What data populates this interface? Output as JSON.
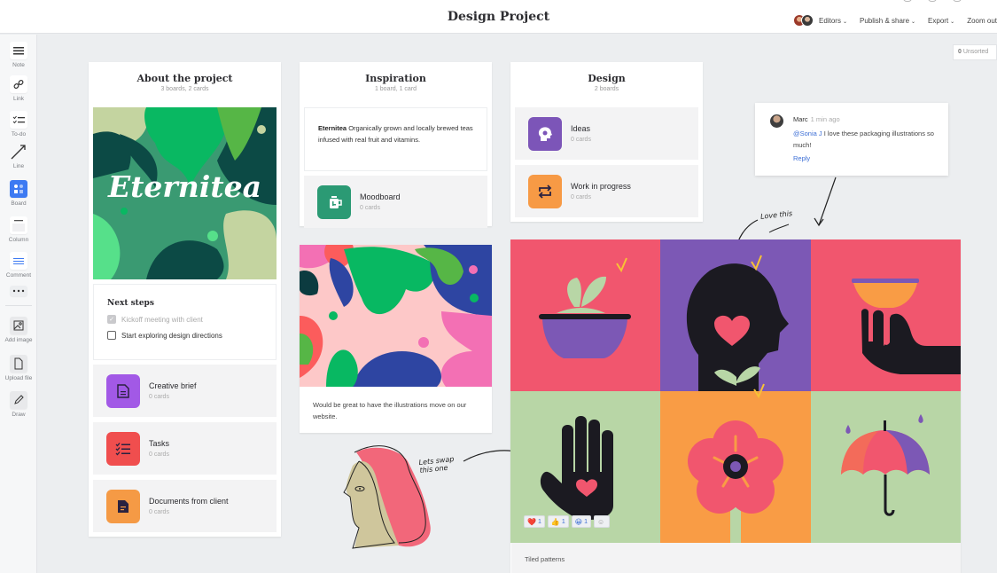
{
  "header": {
    "title": "Design Project",
    "editors_label": "Editors",
    "publish_label": "Publish & share",
    "export_label": "Export",
    "zoom_label": "Zoom out"
  },
  "unsorted": {
    "count": "0",
    "label": "Unsorted"
  },
  "sidebar": {
    "tools": [
      {
        "label": "Note",
        "icon": "note-icon"
      },
      {
        "label": "Link",
        "icon": "link-icon"
      },
      {
        "label": "To-do",
        "icon": "todo-icon"
      },
      {
        "label": "Line",
        "icon": "line-icon"
      },
      {
        "label": "Board",
        "icon": "board-icon"
      },
      {
        "label": "Column",
        "icon": "column-icon"
      },
      {
        "label": "Comment",
        "icon": "comment-icon"
      },
      {
        "label": "",
        "icon": "more-icon"
      },
      {
        "label": "Add image",
        "icon": "add-image-icon"
      },
      {
        "label": "Upload file",
        "icon": "upload-file-icon"
      },
      {
        "label": "Draw",
        "icon": "draw-icon"
      }
    ]
  },
  "columns": {
    "about": {
      "title": "About the project",
      "subtitle": "3 boards, 2 cards",
      "image_text": "Eternitea",
      "next_steps": {
        "title": "Next steps",
        "items": [
          {
            "label": "Kickoff meeting with client",
            "checked": true
          },
          {
            "label": "Start exploring design directions",
            "checked": false
          }
        ]
      },
      "boards": [
        {
          "name": "Creative brief",
          "count": "0 cards",
          "color": "#a259e6"
        },
        {
          "name": "Tasks",
          "count": "0 cards",
          "color": "#f04e4e"
        },
        {
          "name": "Documents from client",
          "count": "0 cards",
          "color": "#f59a45"
        }
      ]
    },
    "inspiration": {
      "title": "Inspiration",
      "subtitle": "1 board, 1 card",
      "note_bold": "Eternitea",
      "note_text": " Organically grown and locally brewed teas infused with real fruit and vitamins.",
      "boards": [
        {
          "name": "Moodboard",
          "count": "0 cards",
          "color": "#2b9a74"
        }
      ],
      "image_caption": "Would be great to have the illustrations move on our website."
    },
    "design": {
      "title": "Design",
      "subtitle": "2 boards",
      "boards": [
        {
          "name": "Ideas",
          "count": "0 cards",
          "color": "#7c55b8"
        },
        {
          "name": "Work in progress",
          "count": "0 cards",
          "color": "#f79a45"
        }
      ]
    }
  },
  "comment": {
    "author": "Marc",
    "time": "1 min ago",
    "mention": "@Sonia J",
    "text": " I love these packaging illustrations so much!",
    "reply_label": "Reply"
  },
  "tiled": {
    "caption": "Tiled patterns",
    "reactions": [
      {
        "emoji": "❤️",
        "count": "1"
      },
      {
        "emoji": "👍",
        "count": "1"
      },
      {
        "emoji": "😀",
        "count": "1"
      }
    ]
  },
  "annotations": {
    "love_this": "Love this",
    "swap_line1": "Lets swap",
    "swap_line2": "this one"
  }
}
